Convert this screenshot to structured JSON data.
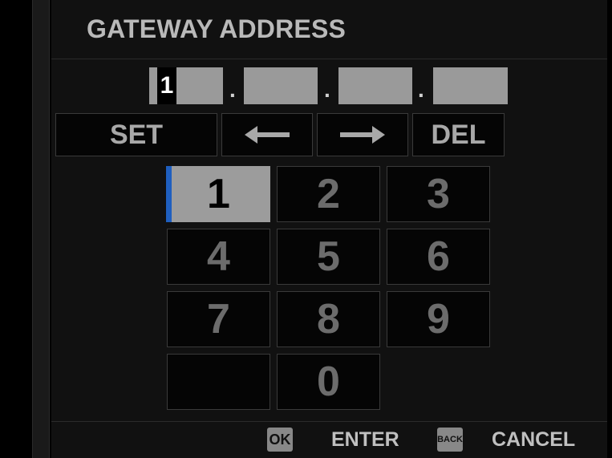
{
  "header": {
    "title": "GATEWAY ADDRESS"
  },
  "address": {
    "octet1_value": "1",
    "separator": "."
  },
  "toolbar": {
    "set_label": "SET",
    "left_icon": "arrow-left-icon",
    "right_icon": "arrow-right-icon",
    "del_label": "DEL"
  },
  "keypad": {
    "keys": [
      "1",
      "2",
      "3",
      "4",
      "5",
      "6",
      "7",
      "8",
      "9",
      "",
      "0"
    ],
    "selected": "1"
  },
  "footer": {
    "ok_badge": "OK",
    "ok_label": "ENTER",
    "back_badge": "BACK",
    "back_label": "CANCEL"
  },
  "colors": {
    "highlight": "#9c9c9c",
    "cursor_marker": "#1f5fbf"
  }
}
